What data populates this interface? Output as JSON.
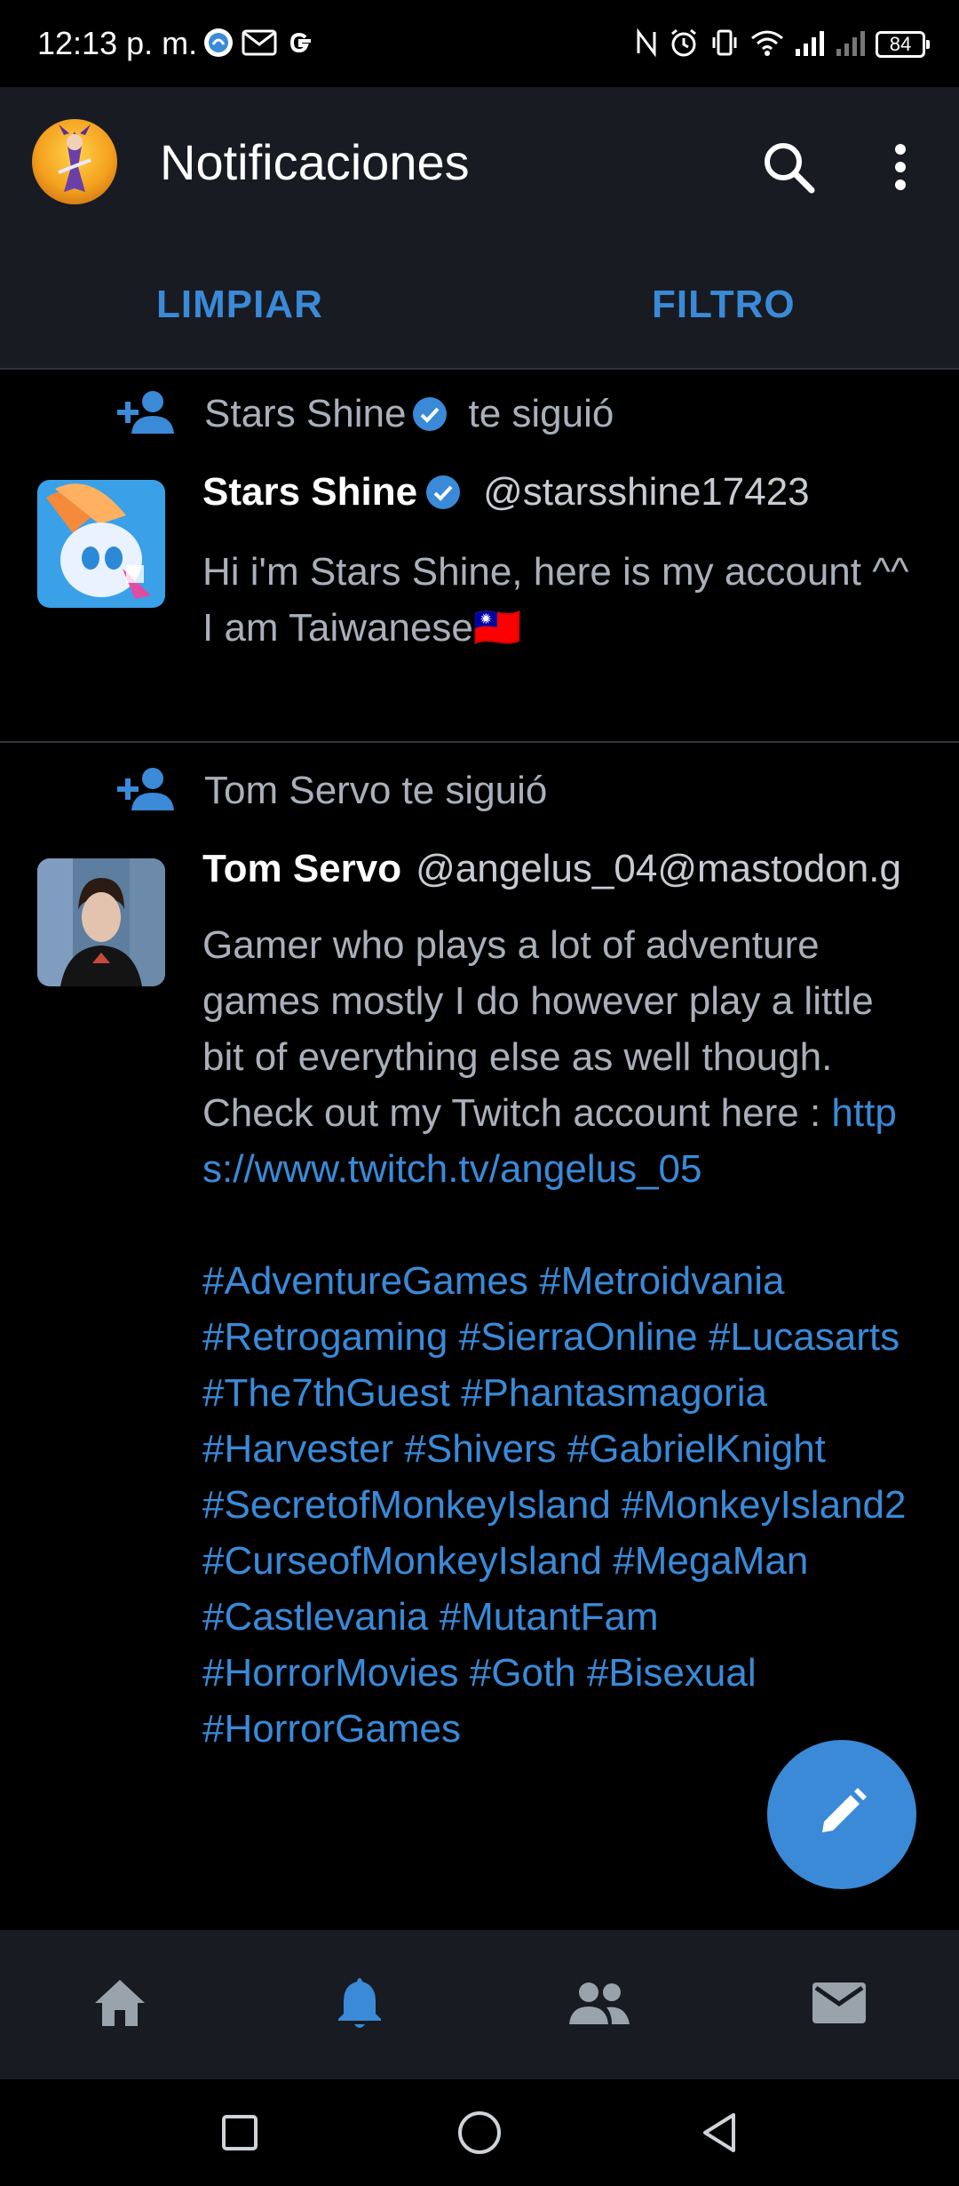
{
  "status_bar": {
    "time": "12:13 p. m.",
    "battery": "84"
  },
  "app_bar": {
    "title": "Notificaciones"
  },
  "tabs": {
    "clear_label": "LIMPIAR",
    "filter_label": "FILTRO"
  },
  "notifications": [
    {
      "header_name": "Stars Shine",
      "header_action": "te siguió",
      "display_name": "Stars Shine",
      "handle": "@starsshine17423",
      "bio_line1": "Hi i'm Stars Shine, here is my account ^^",
      "bio_line2": "I am Taiwanese🇹🇼"
    },
    {
      "header_text": "Tom Servo te siguió",
      "display_name": "Tom Servo",
      "handle": "@angelus_04@mastodon.g",
      "bio_text": "Gamer who plays a lot of adventure games mostly I do however play a little bit of everything else as well though. Check out my Twitch account here : ",
      "bio_link": "https://www.twitch.tv/angelus_05",
      "hashtags": "#AdventureGames #Metroidvania #Retrogaming #SierraOnline #Lucasarts #The7thGuest #Phantasmagoria #Harvester #Shivers #GabrielKnight #SecretofMonkeyIsland #MonkeyIsland2 #CurseofMonkeyIsland #MegaMan #Castlevania #MutantFam #HorrorMovies #Goth #Bisexual #HorrorGames"
    }
  ],
  "colors": {
    "accent": "#3a8ad8",
    "bar_bg": "#181b22",
    "muted_text": "#a9b0ba",
    "verified": "#3a8ad8"
  },
  "icons": {
    "status_left": [
      "mastodon-app-icon",
      "gmail-icon",
      "google-icon"
    ],
    "status_right": [
      "nfc-icon",
      "alarm-icon",
      "vibrate-icon",
      "wifi-icon",
      "signal-icon",
      "signal-icon-2",
      "battery-icon"
    ],
    "app_bar": [
      "search-icon",
      "more-vertical-icon"
    ],
    "bottom_nav": [
      "home-icon",
      "notifications-bell-icon",
      "people-icon",
      "mail-icon"
    ],
    "system_nav": [
      "recents-square-icon",
      "home-circle-icon",
      "back-triangle-icon"
    ],
    "fab": "compose-pencil-icon"
  }
}
